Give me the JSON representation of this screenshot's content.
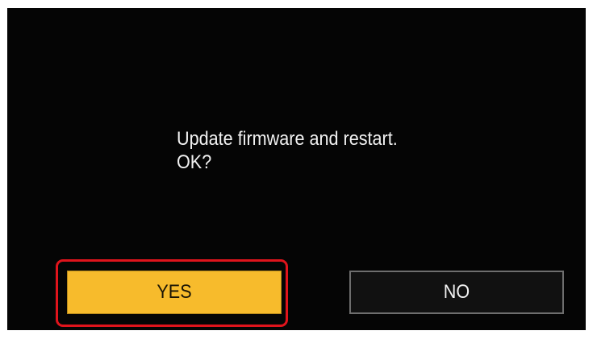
{
  "dialog": {
    "message_line1": "Update firmware and restart.",
    "message_line2": "OK?"
  },
  "buttons": {
    "yes_label": "YES",
    "no_label": "NO",
    "selected": "YES"
  },
  "colors": {
    "background": "#050505",
    "yes_button": "#f7bb2c",
    "no_button": "#111111",
    "highlight_border": "#e0141c",
    "text": "#f2f2f2"
  }
}
